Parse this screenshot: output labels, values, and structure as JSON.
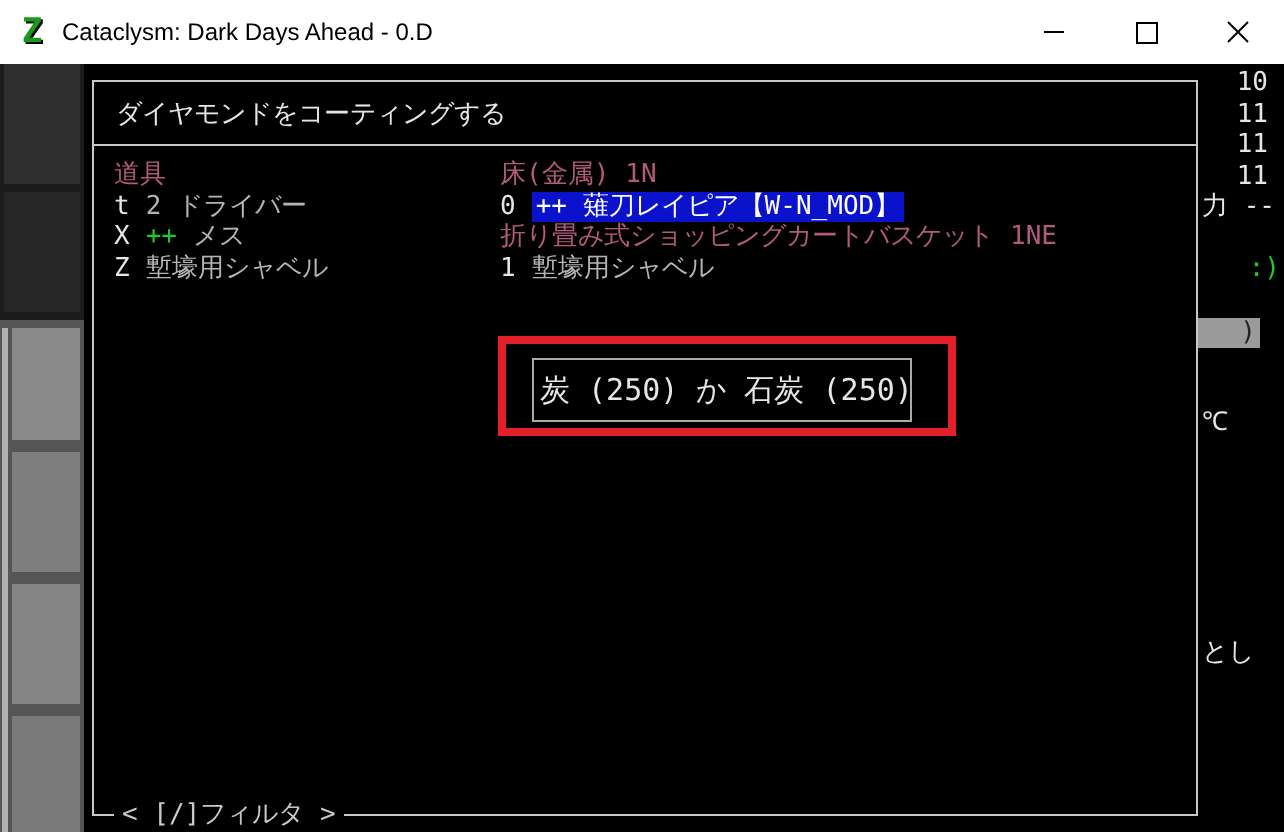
{
  "window": {
    "title": "Cataclysm: Dark Days Ahead - 0.D",
    "icon_letter": "Z"
  },
  "dialog": {
    "title": "ダイヤモンドをコーティングする",
    "columns": [
      {
        "header": [
          {
            "text": "道具",
            "color": "#b35a7c"
          }
        ],
        "items": [
          {
            "selected": false,
            "segments": [
              {
                "text": "t",
                "color": "#e6e6e6"
              },
              {
                "text": "2",
                "color": "#b4b4b4"
              },
              {
                "text": "ドライバー",
                "color": "#b4b4b4"
              }
            ]
          },
          {
            "selected": false,
            "segments": [
              {
                "text": "X",
                "color": "#e6e6e6"
              },
              {
                "text": "++",
                "color": "#22c82a"
              },
              {
                "text": "メス",
                "color": "#b4b4b4"
              }
            ]
          },
          {
            "selected": false,
            "segments": [
              {
                "text": "Z",
                "color": "#e6e6e6"
              },
              {
                "text": "塹壕用シャベル",
                "color": "#b4b4b4"
              }
            ]
          }
        ]
      },
      {
        "header": [
          {
            "text": "床(金属)",
            "color": "#b35a7c"
          },
          {
            "text": "1N",
            "color": "#b35a7c"
          }
        ],
        "items": [
          {
            "selected": true,
            "segments": [
              {
                "text": "0",
                "color": "#e6e6e6"
              },
              {
                "text": "++ 薙刀レイピア【W-N_MOD】"
              }
            ]
          },
          {
            "selected": false,
            "segments": [
              {
                "text": "折り畳み式ショッピングカートバスケット",
                "color": "#b35a7c"
              },
              {
                "text": "1NE",
                "color": "#b35a7c"
              }
            ]
          },
          {
            "selected": false,
            "segments": [
              {
                "text": "1",
                "color": "#e6e6e6"
              },
              {
                "text": "塹壕用シャベル",
                "color": "#b4b4b4"
              }
            ]
          }
        ]
      }
    ],
    "popup": {
      "text": "炭 (250) か 石炭 (250)",
      "highlighted": true
    },
    "footer": "< [/]フィルタ >"
  },
  "sidebar": [
    {
      "kind": "number",
      "text": "10"
    },
    {
      "kind": "number",
      "text": "11"
    },
    {
      "kind": "number",
      "text": "11"
    },
    {
      "kind": "number",
      "text": "11"
    },
    {
      "kind": "text",
      "text": "力 --"
    },
    {
      "kind": "face",
      "text": ":)"
    },
    {
      "kind": "block",
      "text": ")"
    },
    {
      "kind": "text",
      "text": "℃"
    },
    {
      "kind": "text",
      "text": "とし"
    }
  ]
}
